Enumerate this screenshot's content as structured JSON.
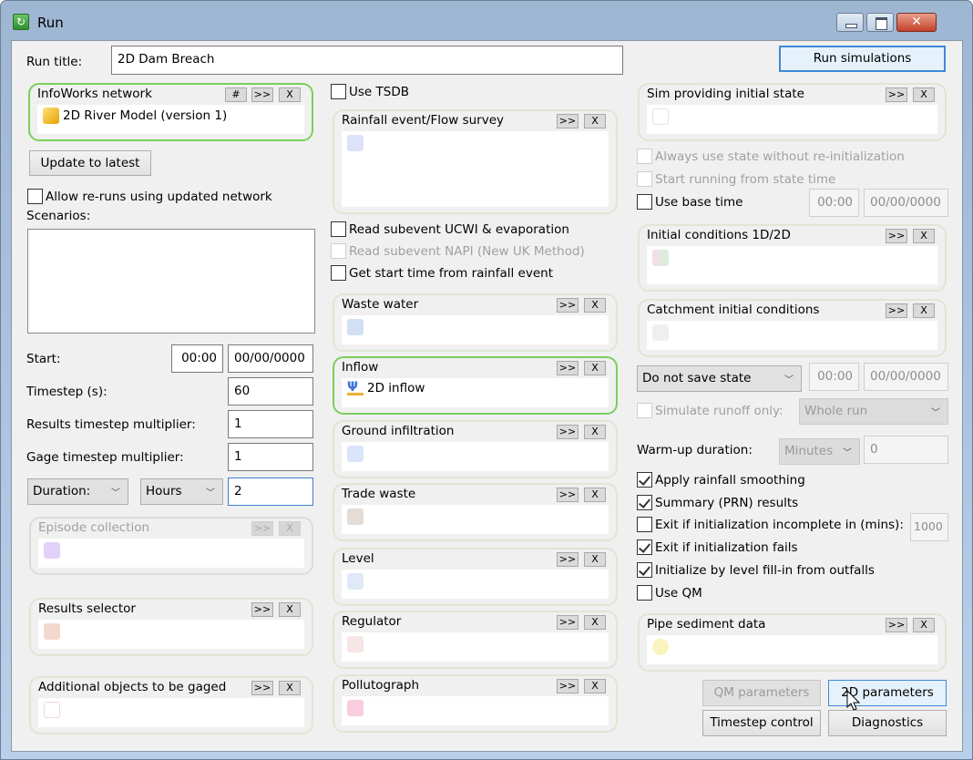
{
  "window": {
    "title": "Run",
    "minimize_label": "",
    "maximize_label": "",
    "close_label": "✕"
  },
  "run_title": {
    "label": "Run title:",
    "value": "2D Dam Breach"
  },
  "run_simulations_label": "Run simulations",
  "left": {
    "network": {
      "title": "InfoWorks network",
      "hash": "#",
      "browse": ">>",
      "clear": "X",
      "item": "2D River Model (version 1)"
    },
    "update_label": "Update to latest",
    "allow_reruns": {
      "label": "Allow re-runs using updated network",
      "checked": false
    },
    "scenarios_label": "Scenarios:",
    "scenarios": [],
    "start": {
      "label": "Start:",
      "time": "00:00",
      "date": "00/00/0000"
    },
    "timestep": {
      "label": "Timestep (s):",
      "value": "60"
    },
    "results_mult": {
      "label": "Results timestep multiplier:",
      "value": "1"
    },
    "gage_mult": {
      "label": "Gage timestep multiplier:",
      "value": "1"
    },
    "duration_mode": "Duration:",
    "duration_unit": "Hours",
    "duration_value": "2",
    "episode": {
      "title": "Episode collection",
      "browse": ">>",
      "clear": "X"
    },
    "results_selector": {
      "title": "Results selector",
      "browse": ">>",
      "clear": "X"
    },
    "gaged": {
      "title": "Additional objects to be gaged",
      "browse": ">>",
      "clear": "X"
    }
  },
  "middle": {
    "use_tsdb": {
      "label": "Use TSDB",
      "checked": false
    },
    "rainfall": {
      "title": "Rainfall event/Flow surveу",
      "browse": ">>",
      "clear": "X"
    },
    "read_ucwi": {
      "label": "Read subevent UCWI & evaporation",
      "checked": false
    },
    "read_napi": {
      "label": "Read subevent NAPI (New UK Method)",
      "checked": false,
      "disabled": true
    },
    "get_start": {
      "label": "Get start time from rainfall event",
      "checked": false
    },
    "waste_water": {
      "title": "Waste water",
      "browse": ">>",
      "clear": "X"
    },
    "inflow": {
      "title": "Inflow",
      "browse": ">>",
      "clear": "X",
      "item": "2D inflow"
    },
    "ground_infiltration": {
      "title": "Ground infiltration",
      "browse": ">>",
      "clear": "X"
    },
    "trade_waste": {
      "title": "Trade waste",
      "browse": ">>",
      "clear": "X"
    },
    "level": {
      "title": "Level",
      "browse": ">>",
      "clear": "X"
    },
    "regulator": {
      "title": "Regulator",
      "browse": ">>",
      "clear": "X"
    },
    "pollutograph": {
      "title": "Pollutograph",
      "browse": ">>",
      "clear": "X"
    }
  },
  "right": {
    "sim_state": {
      "title": "Sim providing initial state",
      "browse": ">>",
      "clear": "X"
    },
    "always_use_state": {
      "label": "Always use state without re-initialization",
      "checked": false,
      "disabled": true
    },
    "start_from_state": {
      "label": "Start running from state time",
      "checked": false,
      "disabled": true
    },
    "use_base_time": {
      "label": "Use base time",
      "checked": false,
      "time": "00:00",
      "date": "00/00/0000"
    },
    "initial_conditions": {
      "title": "Initial conditions 1D/2D",
      "browse": ">>",
      "clear": "X"
    },
    "catchment_ic": {
      "title": "Catchment initial conditions",
      "browse": ">>",
      "clear": "X"
    },
    "save_state": {
      "value": "Do not save state",
      "time": "00:00",
      "date": "00/00/0000"
    },
    "simulate_runoff": {
      "label": "Simulate runoff only:",
      "checked": false,
      "disabled": true,
      "option": "Whole run"
    },
    "warmup": {
      "label": "Warm-up duration:",
      "unit": "Minutes",
      "value": "0"
    },
    "apply_smoothing": {
      "label": "Apply rainfall smoothing",
      "checked": true
    },
    "summary_prn": {
      "label": "Summary (PRN) results",
      "checked": true
    },
    "exit_incomplete": {
      "label": "Exit if initialization incomplete in (mins):",
      "checked": false,
      "value": "1000"
    },
    "exit_fails": {
      "label": "Exit if initialization fails",
      "checked": true
    },
    "init_level_fill": {
      "label": "Initialize by level fill-in from outfalls",
      "checked": true
    },
    "use_qm": {
      "label": "Use QM",
      "checked": false
    },
    "pipe_sediment": {
      "title": "Pipe sediment data",
      "browse": ">>",
      "clear": "X"
    },
    "qm_params_label": "QM parameters",
    "params_2d_label": "2D parameters",
    "timestep_control_label": "Timestep control",
    "diagnostics_label": "Diagnostics"
  },
  "colors": {
    "active_border": "#79d05b",
    "primary_button_border": "#3c8ad6"
  }
}
